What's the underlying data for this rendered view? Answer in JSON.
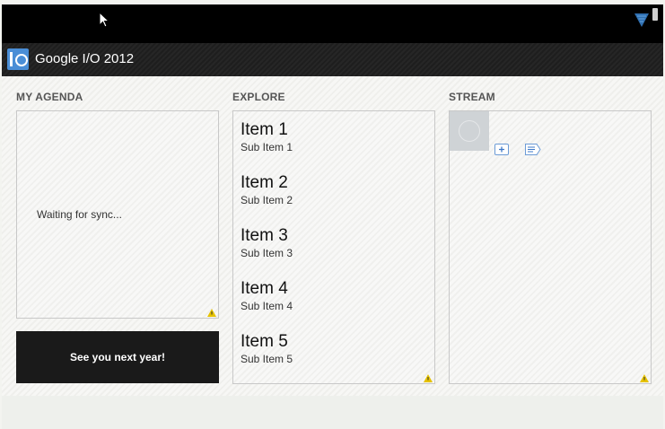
{
  "action_bar": {
    "title": "Google I/O 2012",
    "icon": "google-io-logo-icon"
  },
  "status_bar": {
    "icons": [
      "cursor-icon",
      "wifi-icon",
      "battery-icon"
    ]
  },
  "columns": {
    "agenda": {
      "header": "MY AGENDA",
      "status": "Waiting for sync...",
      "button_label": "See you next year!"
    },
    "explore": {
      "header": "EXPLORE",
      "items": [
        {
          "title": "Item 1",
          "subtitle": "Sub Item 1"
        },
        {
          "title": "Item 2",
          "subtitle": "Sub Item 2"
        },
        {
          "title": "Item 3",
          "subtitle": "Sub Item 3"
        },
        {
          "title": "Item 4",
          "subtitle": "Sub Item 4"
        },
        {
          "title": "Item 5",
          "subtitle": "Sub Item 5"
        }
      ]
    },
    "stream": {
      "header": "STREAM",
      "icons": [
        "avatar-placeholder-icon",
        "google-plus-icon",
        "note-icon"
      ]
    }
  },
  "colors": {
    "accent": "#4a8ed6",
    "action_bar": "#1e1e1e",
    "status_bar": "#000000",
    "warning": "#e6c200"
  }
}
